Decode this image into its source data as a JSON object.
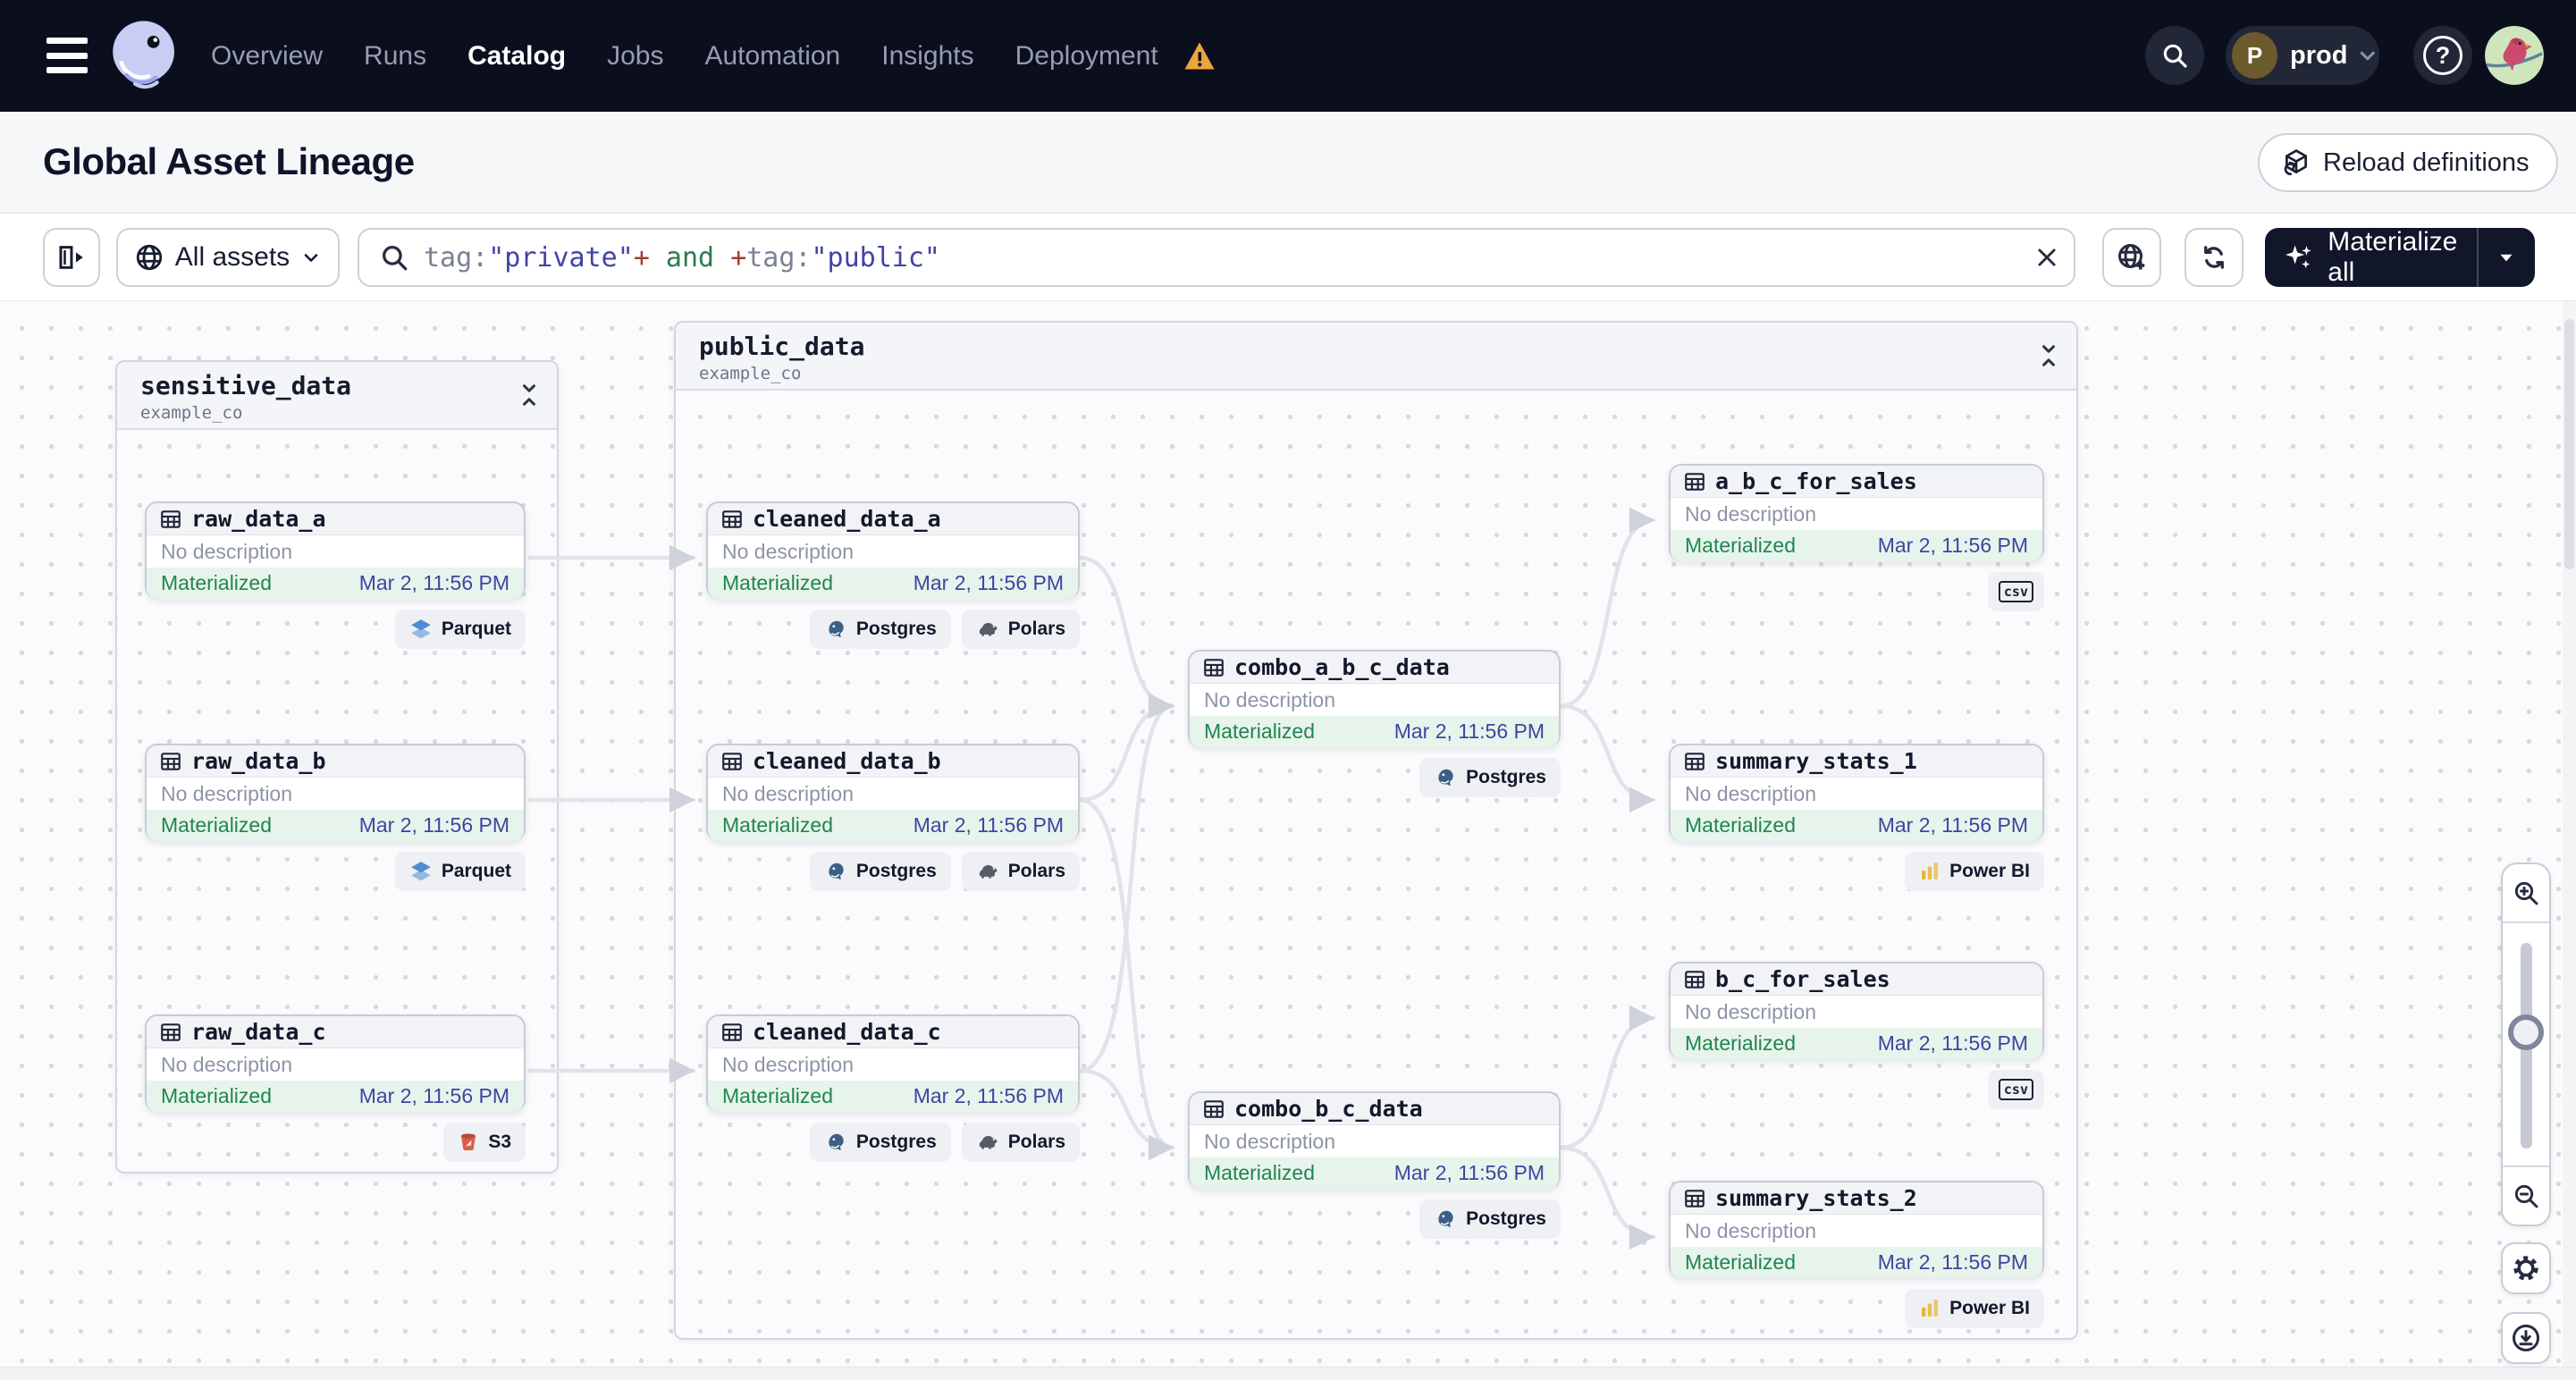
{
  "theme": {
    "nav_bg": "#0b0f1d",
    "accent_dark": "#11162a",
    "status_green": "#21854f",
    "timestamp_indigo": "#3d46a0",
    "warning_orange": "#eda43d",
    "edge_gray": "#e2e3e8"
  },
  "nav": {
    "items": [
      "Overview",
      "Runs",
      "Catalog",
      "Jobs",
      "Automation",
      "Insights",
      "Deployment"
    ],
    "active": "Catalog",
    "environment": {
      "initial": "P",
      "name": "prod"
    },
    "help_glyph": "?"
  },
  "header": {
    "title": "Global Asset Lineage",
    "reload_label": "Reload definitions"
  },
  "toolbar": {
    "filter_label": "All assets",
    "materialize_label": "Materialize all",
    "clear_glyph": "✕",
    "query": {
      "segments": [
        {
          "text": "tag:",
          "type": "key"
        },
        {
          "text": "\"private\"",
          "type": "value"
        },
        {
          "text": "+",
          "type": "op"
        },
        {
          "text": " and ",
          "type": "logic"
        },
        {
          "text": "+",
          "type": "op"
        },
        {
          "text": "tag:",
          "type": "key"
        },
        {
          "text": "\"public\"",
          "type": "value"
        }
      ]
    }
  },
  "canvas": {
    "groups": [
      {
        "name": "sensitive_data",
        "subtitle": "example_co"
      },
      {
        "name": "public_data",
        "subtitle": "example_co"
      }
    ],
    "nodes": [
      {
        "name": "raw_data_a",
        "description": "No description",
        "status": "Materialized",
        "timestamp": "Mar 2, 11:56 PM",
        "badges": [
          "Parquet"
        ]
      },
      {
        "name": "raw_data_b",
        "description": "No description",
        "status": "Materialized",
        "timestamp": "Mar 2, 11:56 PM",
        "badges": [
          "Parquet"
        ]
      },
      {
        "name": "raw_data_c",
        "description": "No description",
        "status": "Materialized",
        "timestamp": "Mar 2, 11:56 PM",
        "badges": [
          "S3"
        ]
      },
      {
        "name": "cleaned_data_a",
        "description": "No description",
        "status": "Materialized",
        "timestamp": "Mar 2, 11:56 PM",
        "badges": [
          "Postgres",
          "Polars"
        ]
      },
      {
        "name": "cleaned_data_b",
        "description": "No description",
        "status": "Materialized",
        "timestamp": "Mar 2, 11:56 PM",
        "badges": [
          "Postgres",
          "Polars"
        ]
      },
      {
        "name": "cleaned_data_c",
        "description": "No description",
        "status": "Materialized",
        "timestamp": "Mar 2, 11:56 PM",
        "badges": [
          "Postgres",
          "Polars"
        ]
      },
      {
        "name": "combo_a_b_c_data",
        "description": "No description",
        "status": "Materialized",
        "timestamp": "Mar 2, 11:56 PM",
        "badges": [
          "Postgres"
        ]
      },
      {
        "name": "combo_b_c_data",
        "description": "No description",
        "status": "Materialized",
        "timestamp": "Mar 2, 11:56 PM",
        "badges": [
          "Postgres"
        ]
      },
      {
        "name": "a_b_c_for_sales",
        "description": "No description",
        "status": "Materialized",
        "timestamp": "Mar 2, 11:56 PM",
        "badges": [
          "csv"
        ]
      },
      {
        "name": "summary_stats_1",
        "description": "No description",
        "status": "Materialized",
        "timestamp": "Mar 2, 11:56 PM",
        "badges": [
          "Power BI"
        ]
      },
      {
        "name": "b_c_for_sales",
        "description": "No description",
        "status": "Materialized",
        "timestamp": "Mar 2, 11:56 PM",
        "badges": [
          "csv"
        ]
      },
      {
        "name": "summary_stats_2",
        "description": "No description",
        "status": "Materialized",
        "timestamp": "Mar 2, 11:56 PM",
        "badges": [
          "Power BI"
        ]
      }
    ]
  }
}
